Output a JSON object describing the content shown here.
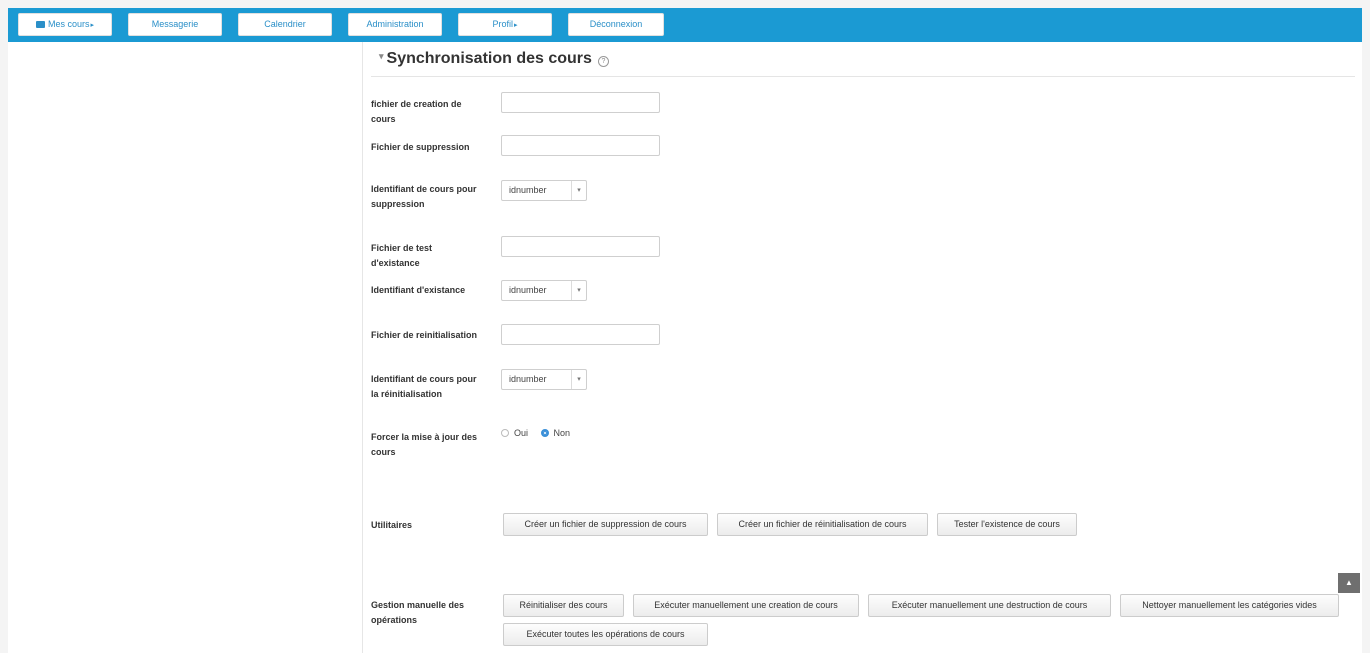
{
  "navbar": {
    "items": [
      {
        "label": "Mes cours",
        "icon": "briefcase-icon",
        "has_caret": true
      },
      {
        "label": "Messagerie"
      },
      {
        "label": "Calendrier"
      },
      {
        "label": "Administration"
      },
      {
        "label": "Profil",
        "has_caret": true
      },
      {
        "label": "Déconnexion"
      }
    ],
    "caret": "▸"
  },
  "section": {
    "toggle": "▾",
    "title": "Synchronisation des cours",
    "help_icon": "help-icon",
    "help_glyph": "?"
  },
  "form": {
    "creation_file": {
      "label": "fichier de creation de cours",
      "value": ""
    },
    "deletion_file": {
      "label": "Fichier de suppression",
      "value": ""
    },
    "deletion_identifier": {
      "label": "Identifiant de cours pour suppression",
      "selected": "idnumber"
    },
    "existence_file": {
      "label": "Fichier de test d'existance",
      "value": ""
    },
    "existence_identifier": {
      "label": "Identifiant d'existance",
      "selected": "idnumber"
    },
    "reset_file": {
      "label": "Fichier de reinitialisation",
      "value": ""
    },
    "reset_identifier": {
      "label": "Identifiant de cours pour la réinitialisation",
      "selected": "idnumber"
    },
    "force_update": {
      "label": "Forcer la mise à jour des cours",
      "options": [
        {
          "label": "Oui",
          "checked": false
        },
        {
          "label": "Non",
          "checked": true
        }
      ]
    },
    "select_arrow": "▾"
  },
  "utilities": {
    "label": "Utilitaires",
    "buttons": [
      "Créer un fichier de suppression de cours",
      "Créer un fichier de réinitialisation de cours",
      "Tester l'existence de cours"
    ]
  },
  "manual": {
    "label": "Gestion manuelle des opérations",
    "buttons": [
      "Réinitialiser des cours",
      "Exécuter manuellement une creation de cours",
      "Exécuter manuellement une destruction de cours",
      "Nettoyer manuellement les catégories vides",
      "Exécuter toutes les opérations de cours"
    ]
  },
  "scroll_top": {
    "glyph": "▲",
    "icon": "arrow-up-icon"
  },
  "colors": {
    "navbar": "#1b9ad3",
    "nav_text": "#2a8fc8",
    "radio_checked": "#3a8fd8"
  }
}
